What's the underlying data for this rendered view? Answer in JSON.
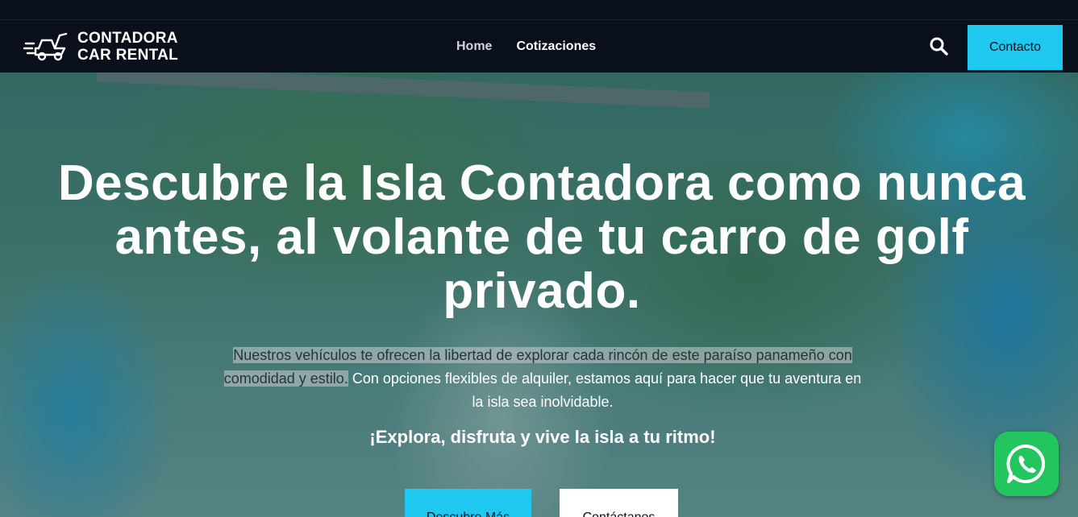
{
  "brand": {
    "line1": "CONTADORA",
    "line2": "CAR RENTAL",
    "logo_icon": "golf-cart-icon"
  },
  "nav": {
    "items": [
      {
        "label": "Home"
      },
      {
        "label": "Cotizaciones"
      }
    ],
    "search_icon": "search-icon",
    "contact_label": "Contacto"
  },
  "hero": {
    "title": "Descubre la Isla Contadora como nunca antes, al volante de tu carro de golf privado.",
    "desc_highlight": "Nuestros vehículos te ofrecen la libertad de explorar cada rincón de este paraíso panameño con comodidad y estilo.",
    "desc_rest": " Con opciones flexibles de alquiler, estamos aquí para hacer que tu aventura en la isla sea inolvidable.",
    "tagline": "¡Explora, disfruta y vive la isla a tu ritmo!",
    "discover_label": "Descubre Más",
    "contact_label": "Contáctanos"
  },
  "floating": {
    "whatsapp_icon": "whatsapp-icon"
  },
  "colors": {
    "accent": "#1ec8ee",
    "navbar": "#0a0f1c",
    "whatsapp": "#22c55e"
  }
}
